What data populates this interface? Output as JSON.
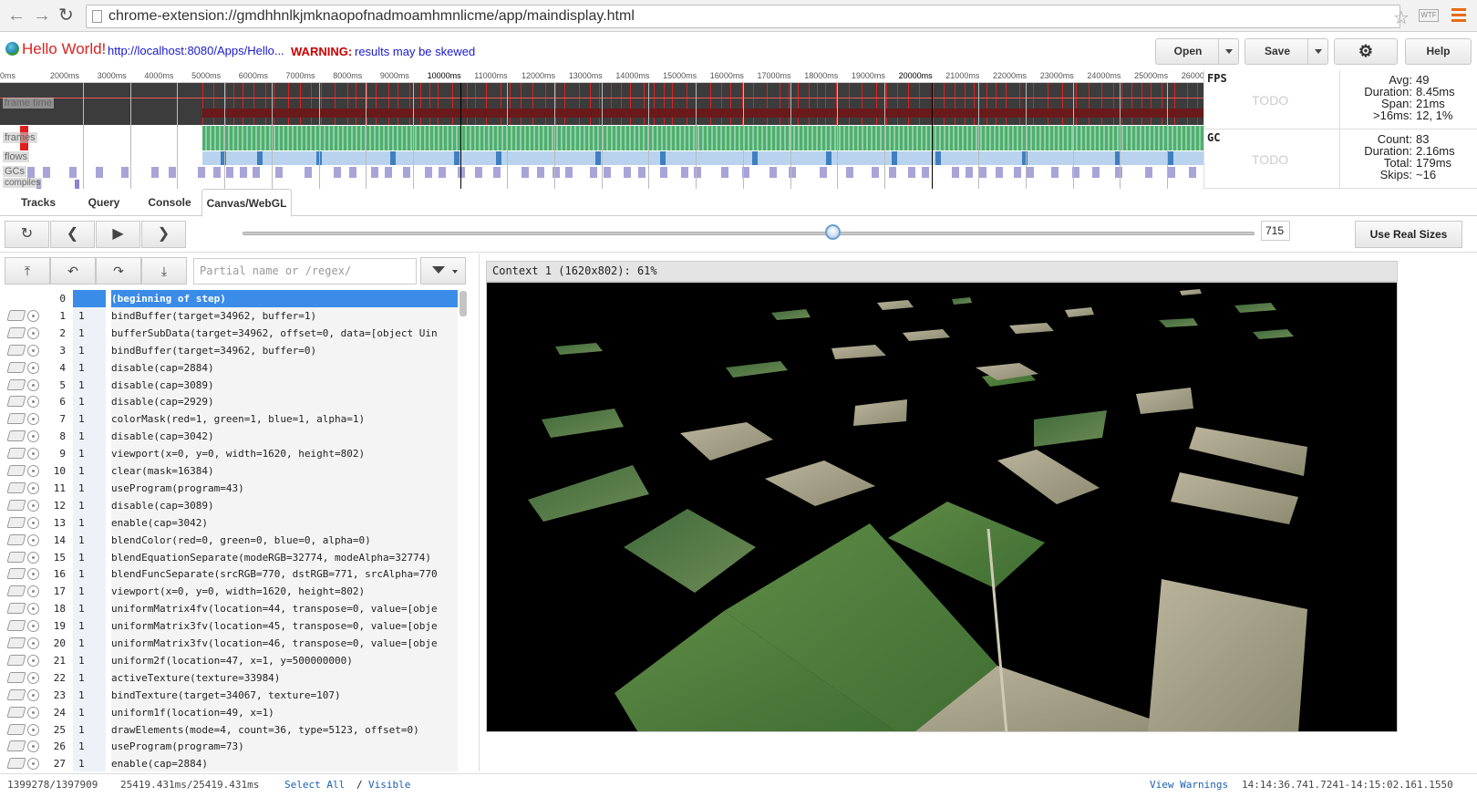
{
  "browser": {
    "address": "chrome-extension://gmdhhnlkjmknaopofnadmoamhmnlicme/app/maindisplay.html",
    "back_icon": "back-arrow-icon",
    "forward_icon": "forward-arrow-icon",
    "reload_icon": "reload-icon",
    "ext_label": "WTF"
  },
  "header": {
    "title": "Hello World!",
    "url": "http://localhost:8080/Apps/Hello...",
    "warning_label": "WARNING:",
    "warning_text": "results may be skewed",
    "open_label": "Open",
    "save_label": "Save",
    "help_label": "Help"
  },
  "timeline": {
    "ruler": [
      "0ms",
      "2000ms",
      "3000ms",
      "4000ms",
      "5000ms",
      "6000ms",
      "7000ms",
      "8000ms",
      "9000ms",
      "10000ms",
      "11000ms",
      "12000ms",
      "13000ms",
      "14000ms",
      "15000ms",
      "16000ms",
      "17000ms",
      "18000ms",
      "19000ms",
      "20000ms",
      "21000ms",
      "22000ms",
      "23000ms",
      "24000ms",
      "25000ms",
      "26000"
    ],
    "track_labels": {
      "frame_time": "frame time",
      "frames": "frames",
      "flows": "flows",
      "gcs": "GCs",
      "compiles": "compiles"
    },
    "colors": {
      "frame_bar": "#e02020",
      "frames_green": "#4fae6f",
      "flows": "#b9d3ee",
      "gcs": "#a9a4d8"
    }
  },
  "stats": {
    "fps": {
      "name": "FPS",
      "todo": "TODO",
      "rows": [
        [
          "Avg:",
          "49"
        ],
        [
          "Duration:",
          "8.45ms"
        ],
        [
          "Span:",
          "21ms"
        ],
        [
          ">16ms:",
          "12, 1%"
        ]
      ]
    },
    "gc": {
      "name": "GC",
      "todo": "TODO",
      "rows": [
        [
          "Count:",
          "83"
        ],
        [
          "Duration:",
          "2.16ms"
        ],
        [
          "Total:",
          "179ms"
        ],
        [
          "Skips:",
          "~16"
        ]
      ]
    }
  },
  "tabs": [
    "Tracks",
    "Query",
    "Console",
    "Canvas/WebGL"
  ],
  "active_tab": "Canvas/WebGL",
  "player": {
    "step": "715",
    "step_fraction": 0.61,
    "real_sizes_label": "Use Real Sizes"
  },
  "filter": {
    "placeholder": "Partial name or /regex/"
  },
  "calls": [
    {
      "n": "0",
      "g": "",
      "t": "(beginning of step)"
    },
    {
      "n": "1",
      "g": "1",
      "t": "bindBuffer(target=34962, buffer=1)"
    },
    {
      "n": "2",
      "g": "1",
      "t": "bufferSubData(target=34962, offset=0, data=[object Uin"
    },
    {
      "n": "3",
      "g": "1",
      "t": "bindBuffer(target=34962, buffer=0)"
    },
    {
      "n": "4",
      "g": "1",
      "t": "disable(cap=2884)"
    },
    {
      "n": "5",
      "g": "1",
      "t": "disable(cap=3089)"
    },
    {
      "n": "6",
      "g": "1",
      "t": "disable(cap=2929)"
    },
    {
      "n": "7",
      "g": "1",
      "t": "colorMask(red=1, green=1, blue=1, alpha=1)"
    },
    {
      "n": "8",
      "g": "1",
      "t": "disable(cap=3042)"
    },
    {
      "n": "9",
      "g": "1",
      "t": "viewport(x=0, y=0, width=1620, height=802)"
    },
    {
      "n": "10",
      "g": "1",
      "t": "clear(mask=16384)"
    },
    {
      "n": "11",
      "g": "1",
      "t": "useProgram(program=43)"
    },
    {
      "n": "12",
      "g": "1",
      "t": "disable(cap=3089)"
    },
    {
      "n": "13",
      "g": "1",
      "t": "enable(cap=3042)"
    },
    {
      "n": "14",
      "g": "1",
      "t": "blendColor(red=0, green=0, blue=0, alpha=0)"
    },
    {
      "n": "15",
      "g": "1",
      "t": "blendEquationSeparate(modeRGB=32774, modeAlpha=32774)"
    },
    {
      "n": "16",
      "g": "1",
      "t": "blendFuncSeparate(srcRGB=770, dstRGB=771, srcAlpha=770"
    },
    {
      "n": "17",
      "g": "1",
      "t": "viewport(x=0, y=0, width=1620, height=802)"
    },
    {
      "n": "18",
      "g": "1",
      "t": "uniformMatrix4fv(location=44, transpose=0, value=[obje"
    },
    {
      "n": "19",
      "g": "1",
      "t": "uniformMatrix3fv(location=45, transpose=0, value=[obje"
    },
    {
      "n": "20",
      "g": "1",
      "t": "uniformMatrix3fv(location=46, transpose=0, value=[obje"
    },
    {
      "n": "21",
      "g": "1",
      "t": "uniform2f(location=47, x=1, y=500000000)"
    },
    {
      "n": "22",
      "g": "1",
      "t": "activeTexture(texture=33984)"
    },
    {
      "n": "23",
      "g": "1",
      "t": "bindTexture(target=34067, texture=107)"
    },
    {
      "n": "24",
      "g": "1",
      "t": "uniform1f(location=49, x=1)"
    },
    {
      "n": "25",
      "g": "1",
      "t": "drawElements(mode=4, count=36, type=5123, offset=0)"
    },
    {
      "n": "26",
      "g": "1",
      "t": "useProgram(program=73)"
    },
    {
      "n": "27",
      "g": "1",
      "t": "enable(cap=2884)"
    }
  ],
  "context": {
    "label": "Context 1 (1620x802): 61%"
  },
  "status": {
    "counts": "1399278/1397909",
    "times": "25419.431ms/25419.431ms",
    "select_all": "Select All",
    "sep": "/",
    "visible": "Visible",
    "view_warnings": "View Warnings",
    "range": "14:14:36.741.7241-14:15:02.161.1550"
  }
}
